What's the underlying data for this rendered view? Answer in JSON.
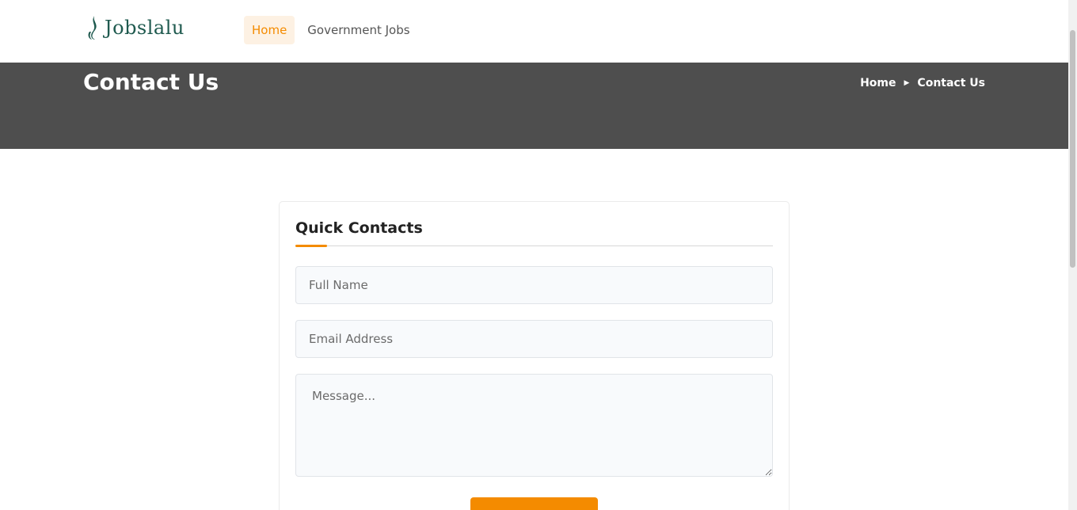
{
  "brand": {
    "name": "Jobslalu",
    "logo_color": "#1f5a4f"
  },
  "nav": {
    "items": [
      {
        "label": "Home",
        "active": true
      },
      {
        "label": "Government Jobs",
        "active": false
      }
    ]
  },
  "hero": {
    "title": "Contact Us",
    "breadcrumb": {
      "home": "Home",
      "current": "Contact Us",
      "separator_icon": "caret-right-icon"
    },
    "bg_color": "#4e4e4e"
  },
  "form": {
    "title": "Quick Contacts",
    "fields": {
      "name": {
        "placeholder": "Full Name",
        "value": ""
      },
      "email": {
        "placeholder": "Email Address",
        "value": ""
      },
      "message": {
        "placeholder": "Message...",
        "value": ""
      }
    },
    "submit_label": ""
  },
  "colors": {
    "accent": "#f48b00",
    "nav_active_bg": "#fdf1e3"
  }
}
